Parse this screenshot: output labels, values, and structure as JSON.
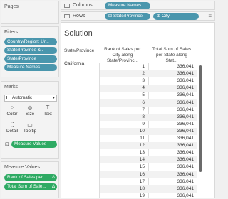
{
  "left": {
    "pages": {
      "title": "Pages"
    },
    "filters": {
      "title": "Filters",
      "pills": [
        "Country/Region: Un..",
        "State/Province &..",
        "State/Province",
        "Measure Names"
      ]
    },
    "marks": {
      "title": "Marks",
      "mark_type": "Automatic",
      "buttons": {
        "color": "Color",
        "size": "Size",
        "text": "Text",
        "detail": "Detail",
        "tooltip": "Tooltip"
      },
      "measure_values_pill": "Measure Values"
    },
    "measure_values": {
      "title": "Measure Values",
      "pills": [
        "Rank of Sales per ...",
        "Total Sum of Sale..."
      ],
      "pill_marker": "Δ"
    }
  },
  "shelves": {
    "columns": {
      "label": "Columns",
      "pills": [
        "Measure Names"
      ]
    },
    "rows": {
      "label": "Rows",
      "pills": [
        "State/Province",
        "City"
      ]
    }
  },
  "view": {
    "title": "Solution",
    "headers": {
      "state": "State/Province",
      "rank": "Rank of Sales per City along State/Provinc...",
      "sum": "Total Sum of Sales per State along Stat..."
    },
    "state_value": "California",
    "rows": [
      {
        "rank": "1",
        "sum": "336,041"
      },
      {
        "rank": "2",
        "sum": "336,041"
      },
      {
        "rank": "3",
        "sum": "336,041"
      },
      {
        "rank": "4",
        "sum": "336,041"
      },
      {
        "rank": "5",
        "sum": "336,041"
      },
      {
        "rank": "6",
        "sum": "336,041"
      },
      {
        "rank": "7",
        "sum": "336,041"
      },
      {
        "rank": "8",
        "sum": "336,041"
      },
      {
        "rank": "9",
        "sum": "336,041"
      },
      {
        "rank": "10",
        "sum": "336,041"
      },
      {
        "rank": "11",
        "sum": "336,041"
      },
      {
        "rank": "12",
        "sum": "336,041"
      },
      {
        "rank": "13",
        "sum": "336,041"
      },
      {
        "rank": "14",
        "sum": "336,041"
      },
      {
        "rank": "15",
        "sum": "336,041"
      },
      {
        "rank": "16",
        "sum": "336,041"
      },
      {
        "rank": "17",
        "sum": "336,041"
      },
      {
        "rank": "18",
        "sum": "336,041"
      },
      {
        "rank": "19",
        "sum": "336,041"
      }
    ]
  },
  "colors": {
    "dimension_pill": "#4a96ad",
    "measure_pill": "#2eaa63"
  }
}
